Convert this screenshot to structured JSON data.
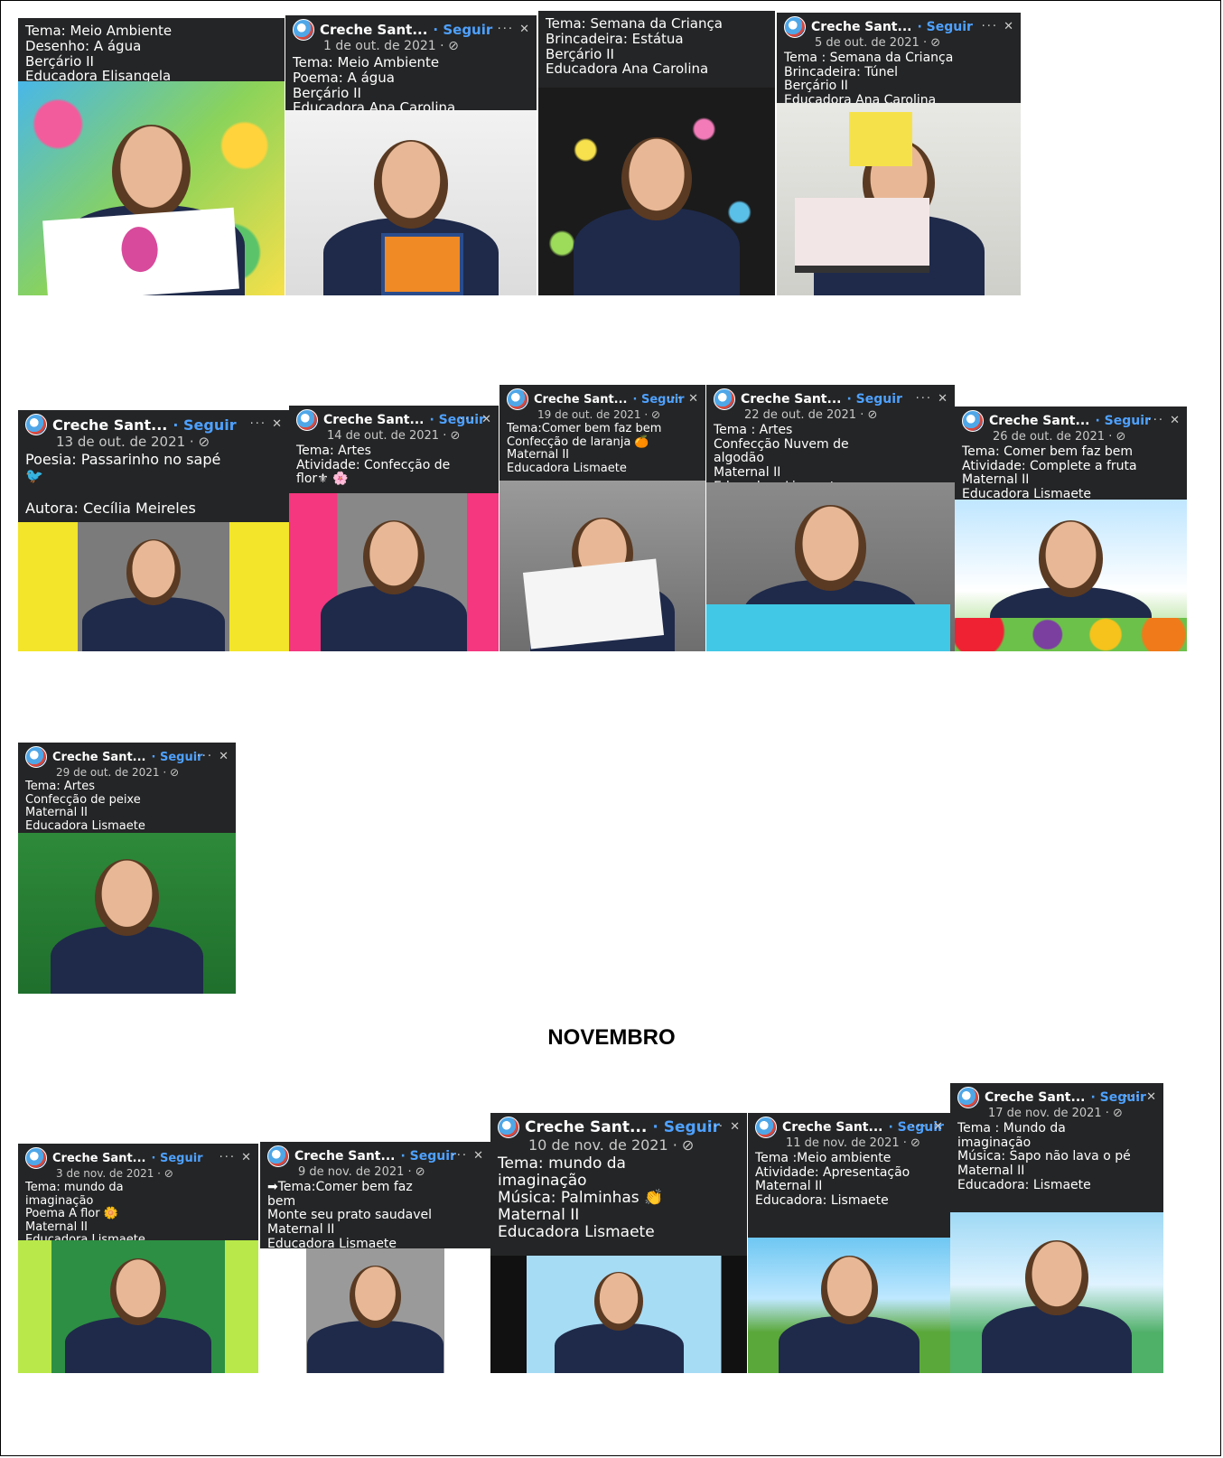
{
  "month_heading": "NOVEMBRO",
  "cards": [
    {
      "fb": false,
      "caption": "Tema: Meio Ambiente\nDesenho: A água\nBerçário II\nEducadora Elisangela"
    },
    {
      "fb": true,
      "page": "Creche Sant...",
      "follow": "· Seguir",
      "date": "1 de out. de 2021 · ⊘",
      "caption": "Tema: Meio Ambiente\nPoema: A água\nBerçário II\n Educadora Ana Carolina"
    },
    {
      "fb": false,
      "caption": "Tema: Semana da Criança\nBrincadeira: Estátua\nBerçário II\nEducadora Ana Carolina"
    },
    {
      "fb": true,
      "page": "Creche Sant...",
      "follow": "· Seguir",
      "date": "5 de out. de 2021 · ⊘",
      "caption": "Tema : Semana da Criança\nBrincadeira: Túnel\nBerçário II\nEducadora Ana  Carolina"
    },
    {
      "fb": true,
      "page": "Creche Sant...",
      "follow": "· Seguir",
      "date": "13 de out. de 2021 · ⊘",
      "caption": "Poesia: Passarinho no sapé\n🐦\n\nAutora: Cecília Meireles"
    },
    {
      "fb": true,
      "page": "Creche Sant...",
      "follow": "· Seguir",
      "date": "14 de out. de 2021 · ⊘",
      "caption": "Tema: Artes\nAtividade: Confecção de\nflor⚜ 🌸"
    },
    {
      "fb": true,
      "page": "Creche Sant...",
      "follow": "· Seguir",
      "date": "19 de out. de 2021 · ⊘",
      "caption": "Tema:Comer bem faz bem\nConfecção de laranja 🍊\nMaternal II\nEducadora Lismaete"
    },
    {
      "fb": true,
      "page": "Creche Sant...",
      "follow": "· Seguir",
      "date": "22 de out. de 2021 · ⊘",
      "caption": "Tema : Artes\nConfecção Nuvem de\nalgodão\nMaternal II\nEducadora Lismaete"
    },
    {
      "fb": true,
      "page": "Creche Sant...",
      "follow": "· Seguir",
      "date": "26 de out. de 2021 · ⊘",
      "caption": "Tema: Comer bem faz bem\nAtividade: Complete  a fruta\nMaternal II\nEducadora Lismaete"
    },
    {
      "fb": true,
      "page": "Creche Sant...",
      "follow": "· Seguir",
      "date": "29 de out. de 2021 · ⊘",
      "caption": "Tema: Artes\nConfecção de peixe\nMaternal II\nEducadora Lismaete"
    },
    {
      "fb": true,
      "page": "Creche Sant...",
      "follow": "· Seguir",
      "date": "3 de nov. de 2021 · ⊘",
      "caption": "Tema: mundo da\nimaginação\nPoema A flor 🌼\nMaternal II\nEducadora Lismaete"
    },
    {
      "fb": true,
      "page": "Creche Sant...",
      "follow": "· Seguir",
      "date": "9 de nov. de 2021 · ⊘",
      "caption": "➡Tema:Comer bem faz\nbem\nMonte seu prato saudavel\nMaternal II\nEducadora  Lismaete"
    },
    {
      "fb": true,
      "page": "Creche Sant...",
      "follow": "· Seguir",
      "date": "10 de nov. de 2021 · ⊘",
      "caption": "Tema: mundo da\nimaginação\nMúsica: Palminhas 👏\nMaternal II\nEducadora Lismaete"
    },
    {
      "fb": true,
      "page": "Creche Sant...",
      "follow": "· Seguir",
      "date": "11 de nov. de 2021 · ⊘",
      "caption": "Tema :Meio ambiente\nAtividade: Apresentação\nMaternal II\nEducadora: Lismaete"
    },
    {
      "fb": true,
      "page": "Creche Sant...",
      "follow": "· Seguir",
      "date": "17 de nov. de 2021 · ⊘",
      "caption": "Tema : Mundo da\nimaginação\nMúsica: Sapo não lava o pé\nMaternal II\nEducadora: Lismaete"
    }
  ],
  "colors": {
    "card_bg": "#242526",
    "follow": "#4ea1ff",
    "shirt": "#1f2a4a"
  }
}
